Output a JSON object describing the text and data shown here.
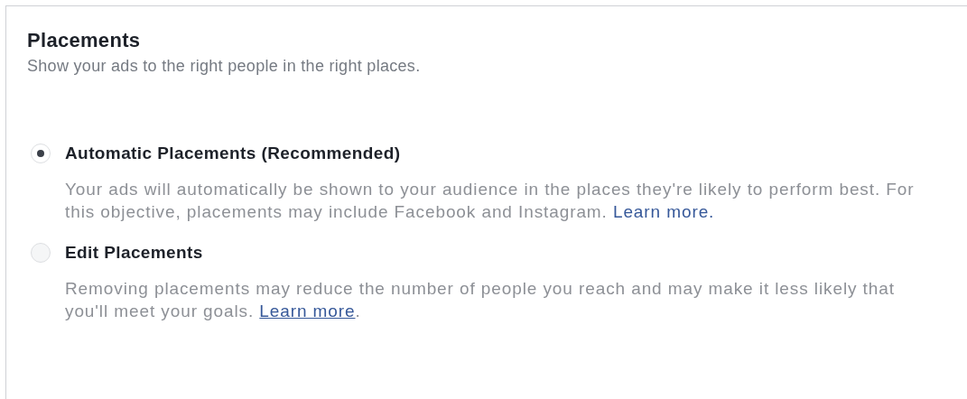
{
  "section": {
    "title": "Placements",
    "subtitle": "Show your ads to the right people in the right places."
  },
  "options": [
    {
      "label": "Automatic Placements (Recommended)",
      "selected": true,
      "description": "Your ads will automatically be shown to your audience in the places they're likely to perform best. For this objective, placements may include Facebook and Instagram.",
      "link": {
        "text": "Learn more.",
        "underlined": false
      }
    },
    {
      "label": "Edit Placements",
      "selected": false,
      "description": "Removing placements may reduce the number of people you reach and may make it less likely that you'll meet your goals.",
      "link": {
        "text": "Learn more",
        "underlined": true
      },
      "after_link": "."
    }
  ]
}
